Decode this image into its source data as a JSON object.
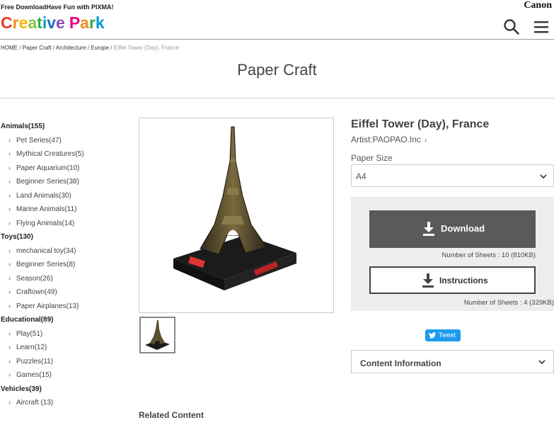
{
  "header": {
    "tagline": "Free DownloadHave Fun with PIXMA!",
    "logo": [
      "C",
      "r",
      "e",
      "a",
      "t",
      "i",
      "v",
      "e",
      " ",
      "P",
      "a",
      "r",
      "k"
    ],
    "logo_colors": [
      "#e73828",
      "#f08c1a",
      "#f5b800",
      "#8cc63f",
      "#2ab24a",
      "#0097d6",
      "#1c6fbf",
      "#8e4fb5",
      "#ffffff",
      "#e6007e",
      "#f08c1a",
      "#2ab24a",
      "#0097d6"
    ],
    "brand": "Canon",
    "search_icon": "search-icon",
    "menu_icon": "hamburger-menu-icon"
  },
  "breadcrumb": {
    "items": [
      "HOME",
      "Paper Craft",
      "Architecture",
      "Europe"
    ],
    "separator": "/",
    "current": "Eiffel Tower (Day), France"
  },
  "page_title": "Paper Craft",
  "sidebar": {
    "categories": [
      {
        "label": "Animals(155)",
        "items": [
          "Pet Series(47)",
          "Mythical Creatures(5)",
          "Paper Aquarium(10)",
          "Beginner Series(38)",
          "Land Animals(30)",
          "Marine Animals(11)",
          "Flying Animals(14)"
        ]
      },
      {
        "label": "Toys(130)",
        "items": [
          "mechanical toy(34)",
          "Beginner Series(8)",
          "Season(26)",
          "Craftown(49)",
          "Paper Airplanes(13)"
        ]
      },
      {
        "label": "Educational(89)",
        "items": [
          "Play(51)",
          "Learn(12)",
          "Puzzles(11)",
          "Games(15)"
        ]
      },
      {
        "label": "Vehicles(39)",
        "items": [
          "Aircraft (13)"
        ]
      }
    ]
  },
  "product": {
    "title": "Eiffel Tower (Day), France",
    "artist": "Artist:PAOPAO.Inc",
    "paper_size_label": "Paper Size",
    "paper_size_value": "A4"
  },
  "download": {
    "button_label": "Download",
    "meta": "Number of Sheets : 10 (810KB)",
    "instructions_label": "Instructions",
    "instructions_meta": "Number of Sheets : 4 (329KB)"
  },
  "tweet_label": "Tweet",
  "content_info_label": "Content Information",
  "related_label": "Related Content",
  "colors": {
    "download_bg": "#5a5a5a",
    "panel_bg": "#eeeeee",
    "tweet_bg": "#1d9bf0"
  }
}
